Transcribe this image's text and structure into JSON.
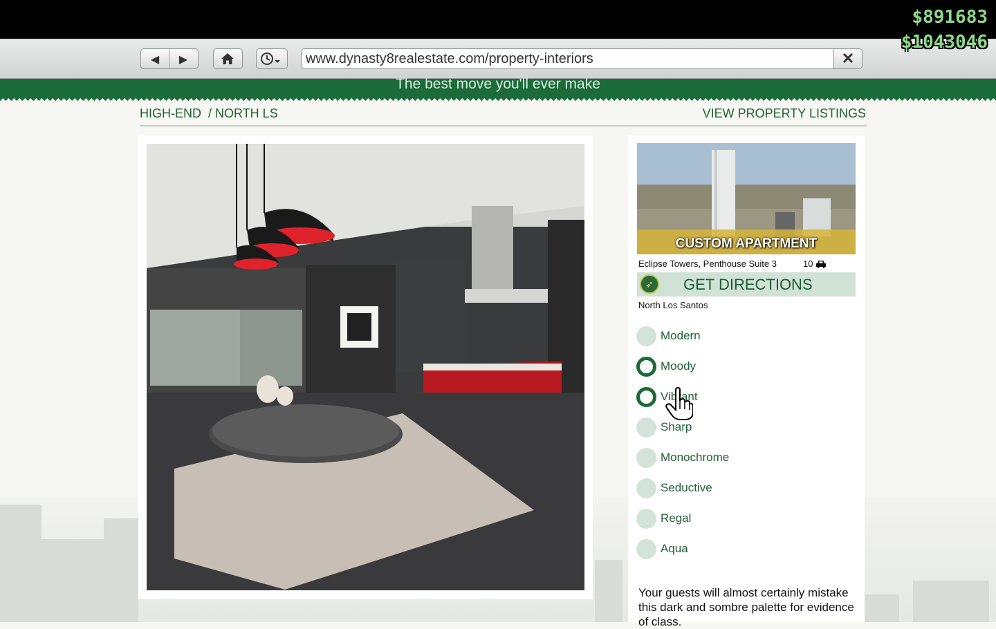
{
  "browser": {
    "url": "www.dynasty8realestate.com/property-interiors",
    "back_icon": "back-arrow-icon",
    "forward_icon": "forward-arrow-icon",
    "home_icon": "home-icon",
    "history_icon": "history-clock-icon",
    "close_icon": "close-icon"
  },
  "hud": {
    "cash": "$891683",
    "bank": "$1043046",
    "money_color": "#8ed98a"
  },
  "site": {
    "tagline": "The best move you'll ever make",
    "brand_color": "#1c6b3a",
    "breadcrumb_1": "HIGH-END",
    "breadcrumb_2": "/ NORTH LS",
    "view_listings": "VIEW PROPERTY LISTINGS"
  },
  "property": {
    "title": "CUSTOM APARTMENT",
    "address": "Eclipse Towers, Penthouse Suite 3",
    "garage_count": "10",
    "garage_icon": "car-icon",
    "directions_label": "GET DIRECTIONS",
    "directions_icon": "compass-icon",
    "district": "North Los Santos"
  },
  "styles": [
    {
      "label": "Modern",
      "selected": false
    },
    {
      "label": "Moody",
      "selected": true
    },
    {
      "label": "Vibrant",
      "selected": true
    },
    {
      "label": "Sharp",
      "selected": false
    },
    {
      "label": "Monochrome",
      "selected": false
    },
    {
      "label": "Seductive",
      "selected": false
    },
    {
      "label": "Regal",
      "selected": false
    },
    {
      "label": "Aqua",
      "selected": false
    }
  ],
  "description": "Your guests will almost certainly mistake this dark and sombre palette for evidence of class."
}
